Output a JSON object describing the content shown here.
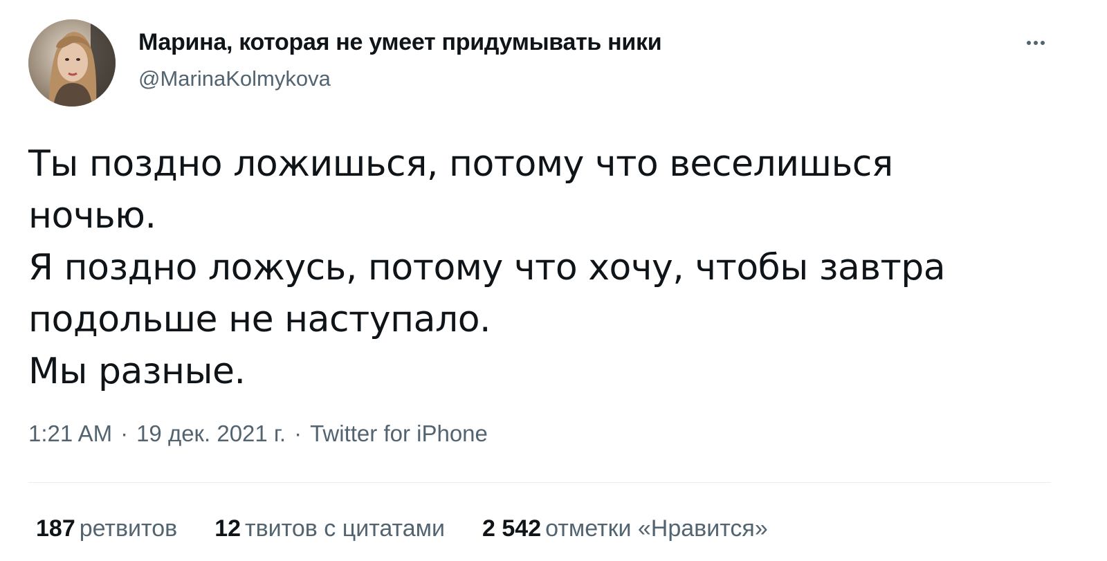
{
  "author": {
    "display_name": "Марина, которая не умеет придумывать ники",
    "handle": "@MarinaKolmykova"
  },
  "tweet": {
    "lines": [
      "Ты поздно ложишься, потому что веселишься",
      "ночью.",
      "Я поздно ложусь, потому что хочу, чтобы завтра",
      "подольше не наступало.",
      "Мы разные."
    ]
  },
  "meta": {
    "time": "1:21 AM",
    "date": "19 дек. 2021 г.",
    "separator": "·",
    "source": "Twitter for iPhone"
  },
  "stats": {
    "retweets": {
      "count": "187",
      "label": "ретвитов"
    },
    "quotes": {
      "count": "12",
      "label": "твитов с цитатами"
    },
    "likes": {
      "count": "2 542",
      "label": "отметки «Нравится»"
    }
  },
  "colors": {
    "text": "#0f1419",
    "secondary": "#536471",
    "divider": "#e6ecf0"
  },
  "icons": {
    "more": "more-horizontal-icon"
  }
}
